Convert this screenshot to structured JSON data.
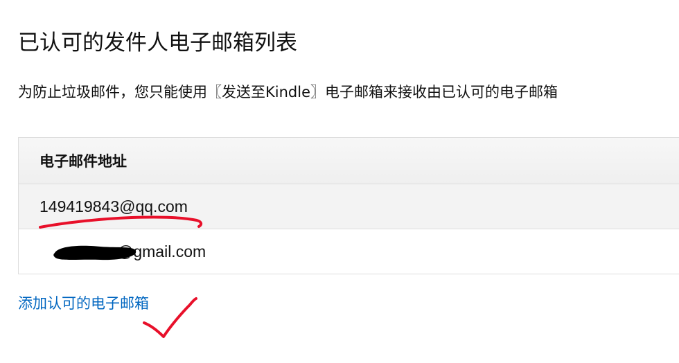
{
  "page": {
    "title": "已认可的发件人电子邮箱列表",
    "description": "为防止垃圾邮件，您只能使用〖发送至Kindle〗电子邮箱来接收由已认可的电子邮箱"
  },
  "table": {
    "header": "电子邮件地址",
    "rows": [
      {
        "email": "149419843@qq.com"
      },
      {
        "email": "@gmail.com"
      }
    ]
  },
  "actions": {
    "add_link": "添加认可的电子邮箱"
  },
  "colors": {
    "link": "#0066c0",
    "annotation": "#e8102a",
    "redaction": "#000000"
  }
}
